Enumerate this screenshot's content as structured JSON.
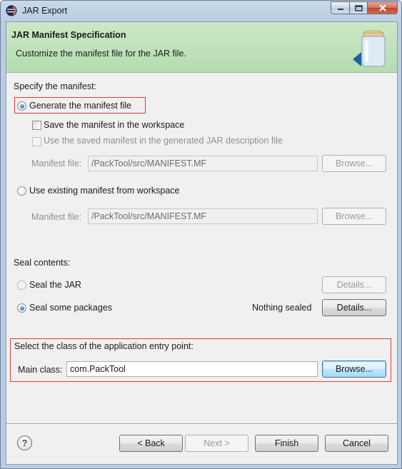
{
  "window": {
    "title": "JAR Export"
  },
  "banner": {
    "title": "JAR Manifest Specification",
    "subtitle": "Customize the manifest file for the JAR file."
  },
  "manifest": {
    "section_label": "Specify the manifest:",
    "generate_label": "Generate the manifest file",
    "generate_checked": true,
    "save_label": "Save the manifest in the workspace",
    "save_checked": false,
    "reuse_label": "Use the saved manifest in the generated JAR description file",
    "reuse_checked": false,
    "file_label_1": "Manifest file:",
    "file_value_1": "/PackTool/src/MANIFEST.MF",
    "browse_label_1": "Browse...",
    "existing_label": "Use existing manifest from workspace",
    "existing_checked": false,
    "file_label_2": "Manifest file:",
    "file_value_2": "/PackTool/src/MANIFEST.MF",
    "browse_label_2": "Browse..."
  },
  "seal": {
    "section_label": "Seal contents:",
    "seal_jar_label": "Seal the JAR",
    "seal_jar_checked": false,
    "details_label_1": "Details...",
    "seal_some_label": "Seal some packages",
    "seal_some_checked": true,
    "status": "Nothing sealed",
    "details_label_2": "Details..."
  },
  "entry_point": {
    "section_label": "Select the class of the application entry point:",
    "main_class_label": "Main class:",
    "main_class_value": "com.PackTool",
    "browse_label": "Browse..."
  },
  "footer": {
    "help_symbol": "?",
    "back_label": "< Back",
    "next_label": "Next >",
    "finish_label": "Finish",
    "cancel_label": "Cancel"
  },
  "icons": {
    "app": "eclipse-icon",
    "banner": "jar-icon",
    "help": "help-icon"
  },
  "colors": {
    "banner_bg": "#b5dcb0",
    "highlight_box": "#e03c3c",
    "radio_selected": "#1d5db3"
  }
}
